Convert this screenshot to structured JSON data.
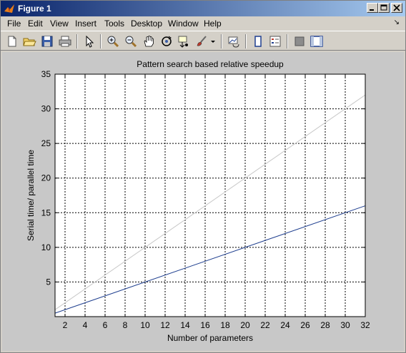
{
  "window": {
    "title": "Figure 1"
  },
  "menu": [
    "File",
    "Edit",
    "View",
    "Insert",
    "Tools",
    "Desktop",
    "Window",
    "Help"
  ],
  "menu_arrow": "↘",
  "toolbar_icons": [
    "new-figure-icon",
    "open-file-icon",
    "save-icon",
    "print-icon",
    "select-arrow-icon",
    "zoom-in-icon",
    "zoom-out-icon",
    "pan-hand-icon",
    "rotate-3d-icon",
    "data-cursor-icon",
    "brush-icon",
    "brush-dropdown-icon",
    "link-plot-icon",
    "hide-plot-tools-icon",
    "show-plot-tools-icon",
    "colorbar-icon",
    "legend-icon"
  ],
  "chart_data": {
    "type": "line",
    "title": "Pattern search based relative speedup",
    "xlabel": "Number of parameters",
    "ylabel": "Serial time/ parallel time",
    "xlim": [
      1,
      32
    ],
    "ylim": [
      0,
      35
    ],
    "xticks": [
      2,
      4,
      6,
      8,
      10,
      12,
      14,
      16,
      18,
      20,
      22,
      24,
      26,
      28,
      30,
      32
    ],
    "yticks": [
      5,
      10,
      15,
      20,
      25,
      30,
      35
    ],
    "grid": true,
    "series": [
      {
        "x": [
          1,
          32
        ],
        "y": [
          1,
          32
        ],
        "color": "#c8c8c8"
      },
      {
        "x": [
          1,
          32
        ],
        "y": [
          0.5,
          16
        ],
        "color": "#1f3f8f"
      }
    ]
  },
  "colors": {
    "titlebar_start": "#0a246a",
    "titlebar_end": "#a6caf0",
    "figure_bg": "#c8c8c8"
  }
}
